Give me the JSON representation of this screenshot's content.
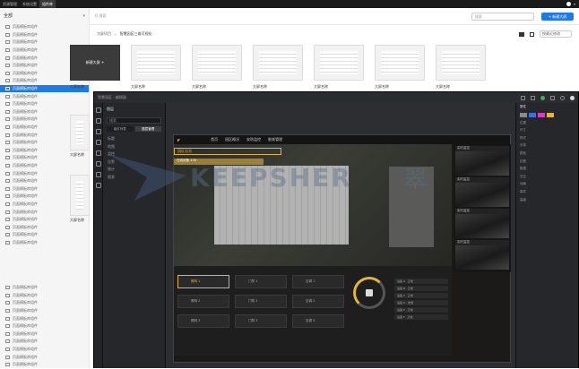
{
  "topbar": {
    "tabs": [
      "资源管理",
      "系统设置",
      "组件库"
    ],
    "active_index": 2
  },
  "sidebar": {
    "title": "全部",
    "items": [
      "页面模板库组件",
      "页面模板库组件",
      "页面模板库组件",
      "页面模板库组件",
      "页面模板库组件",
      "页面模板库组件",
      "页面模板库组件",
      "页面模板库组件",
      "页面模板库组件",
      "页面模板库组件",
      "页面模板库组件",
      "页面模板库组件",
      "页面模板库组件",
      "页面模板库组件",
      "页面模板库组件",
      "页面模板库组件",
      "页面模板库组件",
      "页面模板库组件",
      "页面模板库组件",
      "页面模板库组件",
      "页面模板库组件",
      "页面模板库组件",
      "页面模板库组件",
      "页面模板库组件",
      "页面模板库组件",
      "页面模板库组件",
      "页面模板库组件",
      "页面模板库组件",
      "页面模板库组件"
    ],
    "active_index": 8,
    "lower_items": [
      "页面模板库组件",
      "页面模板库组件",
      "页面模板库组件",
      "页面模板库组件",
      "页面模板库组件",
      "页面模板库组件",
      "页面模板库组件",
      "页面模板库组件",
      "页面模板库组件",
      "页面模板库组件",
      "页面模板库组件"
    ]
  },
  "header": {
    "search_label": "Q 搜索",
    "search_placeholder": "搜索",
    "new_button": "+ 新建大屏"
  },
  "breadcrumb": {
    "root": "大屏项目",
    "current": "智慧园区三维可视化"
  },
  "sort_select": "按最近修改",
  "cards": [
    {
      "label": "新建大屏 +",
      "caption": "大屏名称"
    },
    {
      "label": "",
      "caption": "大屏名称"
    },
    {
      "label": "",
      "caption": "大屏名称"
    },
    {
      "label": "",
      "caption": "大屏名称"
    },
    {
      "label": "",
      "caption": "大屏名称"
    },
    {
      "label": "",
      "caption": "大屏名称"
    },
    {
      "label": "",
      "caption": "大屏名称"
    }
  ],
  "left_card_captions": [
    "大屏名称",
    "大屏名称"
  ],
  "app": {
    "title": "智慧园区 · 编辑器",
    "panel_title": "图层",
    "search_placeholder": "搜索",
    "tabs": [
      "组件列表",
      "图层管理"
    ],
    "active_tab": 1,
    "layers": [
      "标题",
      "地图",
      "监控",
      "告警",
      "统计",
      "图表"
    ],
    "stage_logo": "◤",
    "stage_tabs": [
      "首页",
      "园区概况",
      "安防监控",
      "能耗管理"
    ],
    "map_banner": "园区总览",
    "map_sub": "在线设备 128",
    "camera_title": "实时监控",
    "controls": [
      {
        "label": "照明 1",
        "on": true
      },
      {
        "label": "照明 2",
        "on": false
      },
      {
        "label": "照明 3",
        "on": false
      },
      {
        "label": "门禁 1",
        "on": false
      },
      {
        "label": "门禁 2",
        "on": false
      },
      {
        "label": "门禁 3",
        "on": false
      },
      {
        "label": "空调 1",
        "on": false
      },
      {
        "label": "空调 2",
        "on": false
      },
      {
        "label": "空调 3",
        "on": false
      }
    ],
    "table_rows": [
      "设备 A · 正常",
      "设备 B · 正常",
      "设备 C · 正常",
      "设备 D · 告警",
      "设备 E · 正常",
      "设备 F · 正常"
    ],
    "right_title": "属性",
    "right_items": [
      "位置",
      "尺寸",
      "样式",
      "字体",
      "颜色",
      "边框",
      "数据",
      "交互",
      "动画",
      "事件",
      "高级"
    ],
    "swatches": [
      "#8a8a8a",
      "#3b6fd9",
      "#d93bc6",
      "#e4b33b"
    ],
    "accent": "#e4b33b"
  },
  "watermark": {
    "text": "KEEPSHER",
    "cn": "翠"
  }
}
